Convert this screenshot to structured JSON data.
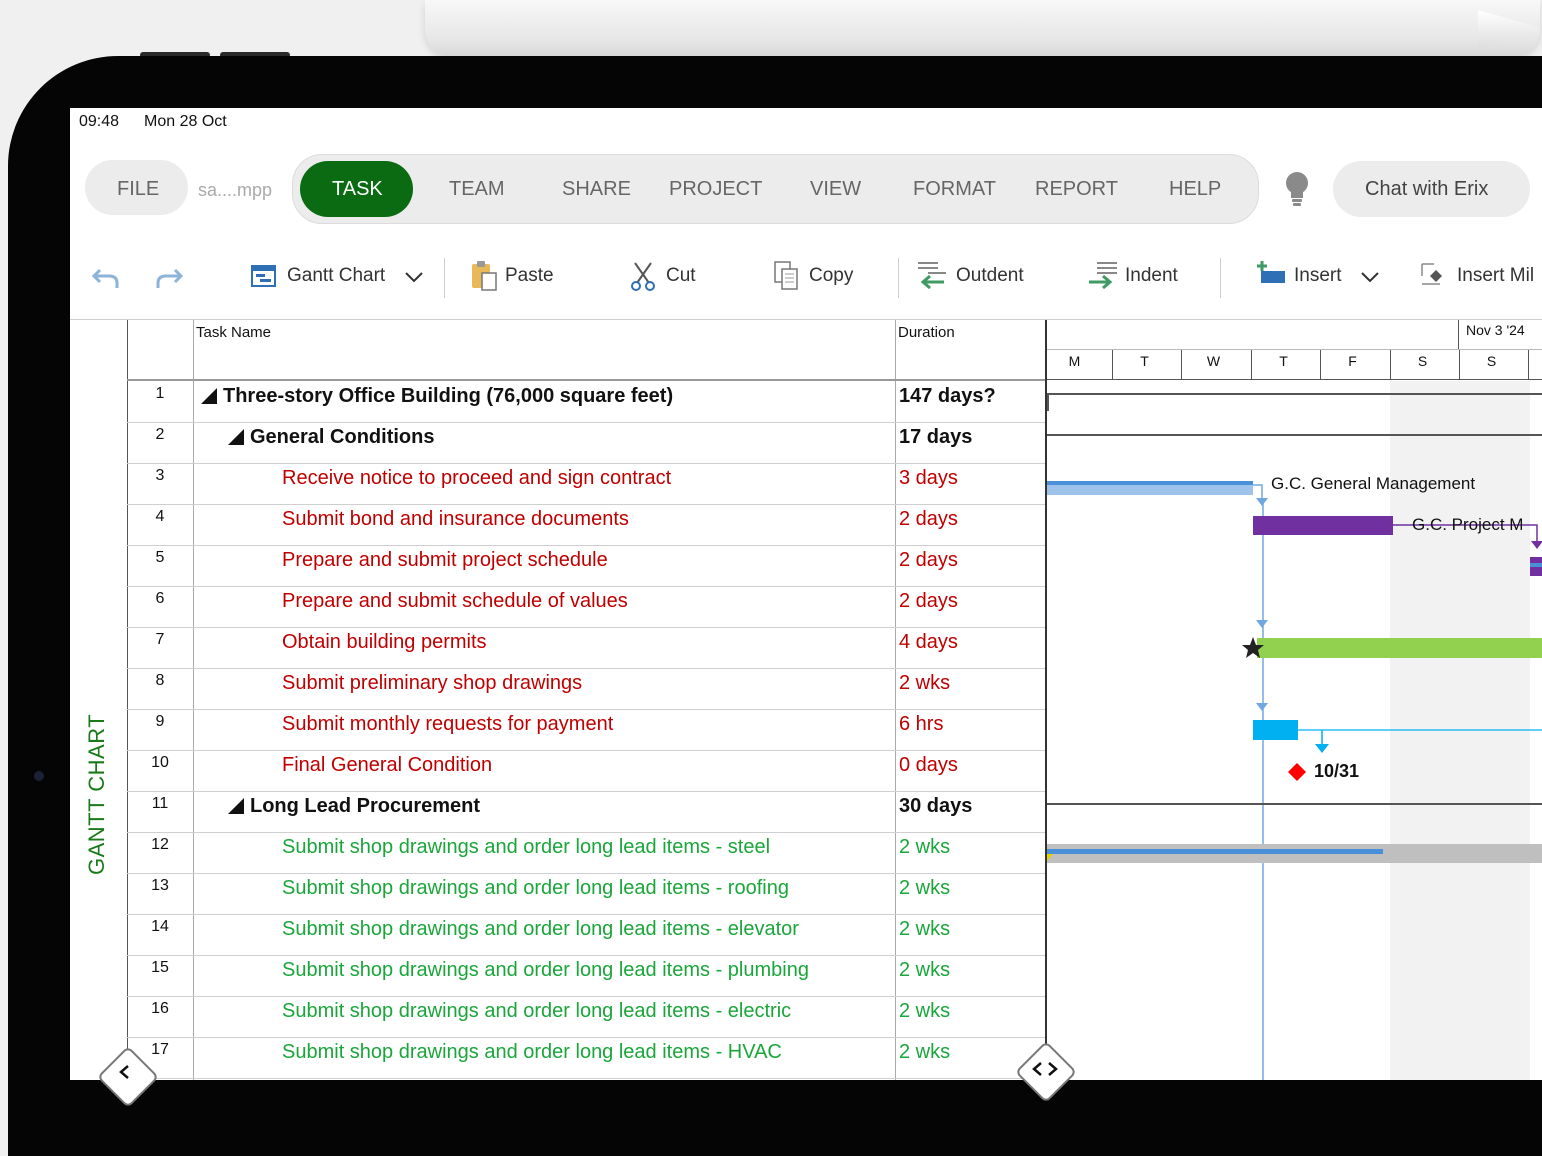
{
  "status_bar": {
    "time": "09:48",
    "date": "Mon 28 Oct"
  },
  "file_menu": {
    "label": "FILE",
    "filename": "sa....mpp"
  },
  "tabs": [
    {
      "label": "TASK",
      "active": true
    },
    {
      "label": "TEAM"
    },
    {
      "label": "SHARE"
    },
    {
      "label": "PROJECT"
    },
    {
      "label": "VIEW"
    },
    {
      "label": "FORMAT"
    },
    {
      "label": "REPORT"
    },
    {
      "label": "HELP"
    }
  ],
  "chat_button": {
    "label": "Chat with Erix"
  },
  "toolbar": {
    "view_label": "Gantt Chart",
    "paste_label": "Paste",
    "cut_label": "Cut",
    "copy_label": "Copy",
    "outdent_label": "Outdent",
    "indent_label": "Indent",
    "insert_label": "Insert",
    "insert_milestone_label": "Insert Mil"
  },
  "view_name": "GANTT CHART",
  "table": {
    "col_task_name": "Task Name",
    "col_duration": "Duration",
    "rows": [
      {
        "id": "1",
        "name": "Three-story Office Building (76,000 square feet)",
        "duration": "147 days?",
        "level": 0,
        "summary": true
      },
      {
        "id": "2",
        "name": "General Conditions",
        "duration": "17 days",
        "level": 1,
        "summary": true
      },
      {
        "id": "3",
        "name": "Receive notice to proceed and sign contract",
        "duration": "3 days",
        "level": 2,
        "color": "red"
      },
      {
        "id": "4",
        "name": "Submit bond and insurance documents",
        "duration": "2 days",
        "level": 2,
        "color": "red"
      },
      {
        "id": "5",
        "name": "Prepare and submit project schedule",
        "duration": "2 days",
        "level": 2,
        "color": "red"
      },
      {
        "id": "6",
        "name": "Prepare and submit schedule of values",
        "duration": "2 days",
        "level": 2,
        "color": "red"
      },
      {
        "id": "7",
        "name": "Obtain building permits",
        "duration": "4 days",
        "level": 2,
        "color": "red"
      },
      {
        "id": "8",
        "name": "Submit preliminary shop drawings",
        "duration": "2 wks",
        "level": 2,
        "color": "red"
      },
      {
        "id": "9",
        "name": "Submit monthly requests for payment",
        "duration": "6 hrs",
        "level": 2,
        "color": "red"
      },
      {
        "id": "10",
        "name": "Final General Condition",
        "duration": "0 days",
        "level": 2,
        "color": "red"
      },
      {
        "id": "11",
        "name": "Long Lead Procurement",
        "duration": "30 days",
        "level": 1,
        "summary": true
      },
      {
        "id": "12",
        "name": "Submit shop drawings and order long lead items - steel",
        "duration": "2 wks",
        "level": 2,
        "color": "green"
      },
      {
        "id": "13",
        "name": "Submit shop drawings and order long lead items - roofing",
        "duration": "2 wks",
        "level": 2,
        "color": "green"
      },
      {
        "id": "14",
        "name": "Submit shop drawings and order long lead items - elevator",
        "duration": "2 wks",
        "level": 2,
        "color": "green"
      },
      {
        "id": "15",
        "name": "Submit shop drawings and order long lead items - plumbing",
        "duration": "2 wks",
        "level": 2,
        "color": "green"
      },
      {
        "id": "16",
        "name": "Submit shop drawings and order long lead items - electric",
        "duration": "2 wks",
        "level": 2,
        "color": "green"
      },
      {
        "id": "17",
        "name": "Submit shop drawings and order long lead items - HVAC",
        "duration": "2 wks",
        "level": 2,
        "color": "green"
      }
    ]
  },
  "timeline": {
    "week_label": "Nov 3 '24",
    "days": [
      "M",
      "T",
      "W",
      "T",
      "F",
      "S",
      "S"
    ],
    "labels": {
      "gc_general_management": "G.C. General Management",
      "gc_project_manager": "G.C. Project M",
      "milestone_date": "10/31"
    }
  },
  "colors": {
    "task_tab": "#0a6b12",
    "red_task": "#c00000",
    "green_task": "#1aa63a",
    "bar_blue": "#4a90d9",
    "bar_purple": "#7030a0",
    "bar_green": "#92d050",
    "bar_cyan": "#00b0f0",
    "milestone": "#ff0000"
  }
}
